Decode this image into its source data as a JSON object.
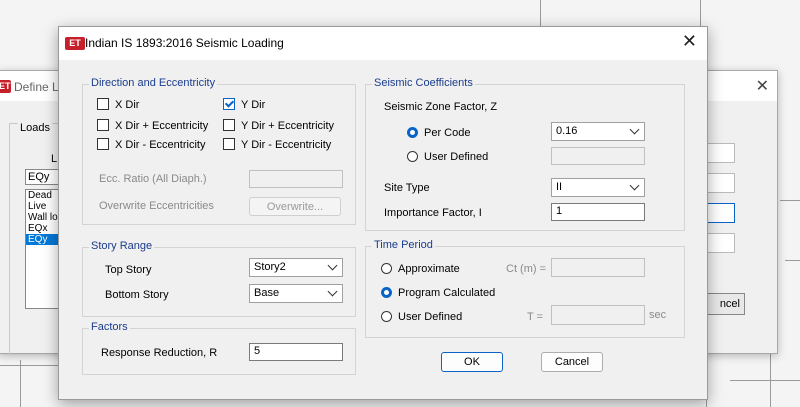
{
  "background_dialog": {
    "title": "Define L",
    "loads_group_label": "Loads",
    "load_name_label": "L",
    "load_name_value": "EQy",
    "loads": [
      "Dead",
      "Live",
      "Wall lo",
      "EQx",
      "EQy"
    ],
    "selected_load_index": 4,
    "cancel_label": "ncel"
  },
  "dialog": {
    "title": "Indian IS 1893:2016 Seismic Loading",
    "logo_text": "ET",
    "direction": {
      "group_label": "Direction and Eccentricity",
      "options": [
        {
          "label": "X Dir",
          "checked": false
        },
        {
          "label": "Y Dir",
          "checked": true
        },
        {
          "label": "X Dir + Eccentricity",
          "checked": false
        },
        {
          "label": "Y Dir + Eccentricity",
          "checked": false
        },
        {
          "label": "X Dir - Eccentricity",
          "checked": false
        },
        {
          "label": "Y Dir - Eccentricity",
          "checked": false
        }
      ],
      "ecc_ratio_label": "Ecc. Ratio (All Diaph.)",
      "ecc_ratio_value": "",
      "overwrite_label": "Overwrite Eccentricities",
      "overwrite_button": "Overwrite..."
    },
    "story_range": {
      "group_label": "Story Range",
      "top_story_label": "Top Story",
      "top_story_value": "Story2",
      "bottom_story_label": "Bottom Story",
      "bottom_story_value": "Base"
    },
    "factors": {
      "group_label": "Factors",
      "response_reduction_label": "Response Reduction, R",
      "response_reduction_value": "5"
    },
    "seismic": {
      "group_label": "Seismic Coefficients",
      "zone_factor_label": "Seismic Zone Factor, Z",
      "per_code_label": "Per Code",
      "per_code_selected": true,
      "per_code_value": "0.16",
      "user_defined_label": "User Defined",
      "user_defined_value": "",
      "site_type_label": "Site Type",
      "site_type_value": "II",
      "importance_label": "Importance Factor, I",
      "importance_value": "1"
    },
    "time_period": {
      "group_label": "Time Period",
      "approximate_label": "Approximate",
      "ct_label": "Ct (m) =",
      "ct_value": "",
      "program_calculated_label": "Program Calculated",
      "selected": "Program Calculated",
      "user_defined_label": "User Defined",
      "t_label": "T =",
      "t_value": "",
      "sec_label": "sec"
    },
    "ok_label": "OK",
    "cancel_label": "Cancel"
  }
}
